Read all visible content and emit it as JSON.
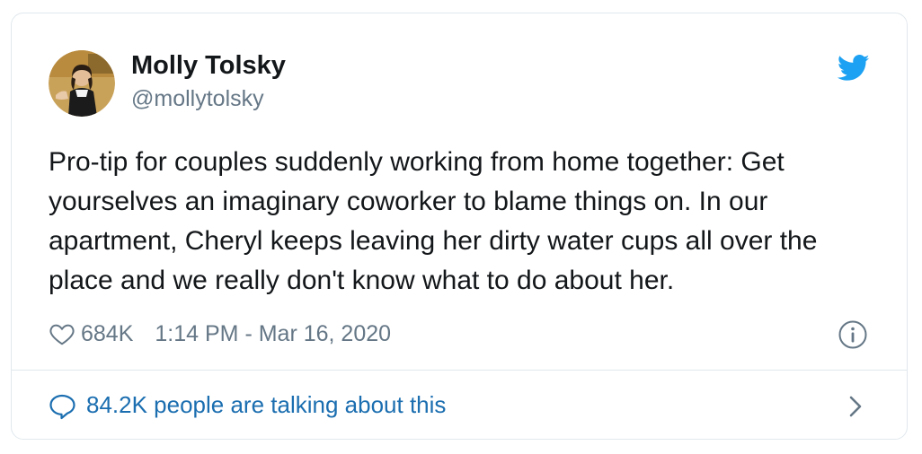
{
  "author": {
    "name": "Molly Tolsky",
    "handle": "@mollytolsky",
    "avatar_icon": "profile-photo"
  },
  "tweet": {
    "text": "Pro-tip for couples suddenly working from home together: Get\nyourselves an imaginary coworker to blame things on. In our\napartment, Cheryl keeps leaving her dirty water cups all over the\nplace and we really don't know what to do about her.",
    "likes": "684K",
    "timestamp": "1:14 PM - Mar 16, 2020"
  },
  "footer": {
    "conversation_label": "84.2K people are talking about this"
  },
  "icons": {
    "brand": "twitter-bird-icon",
    "like": "heart-icon",
    "info": "info-icon",
    "conversation": "speech-bubble-icon",
    "chevron": "chevron-right-icon"
  },
  "colors": {
    "brand": "#1da1f2",
    "link": "#1b6eb0",
    "muted": "#657786",
    "text": "#14171a",
    "border": "#e1e8ed"
  }
}
